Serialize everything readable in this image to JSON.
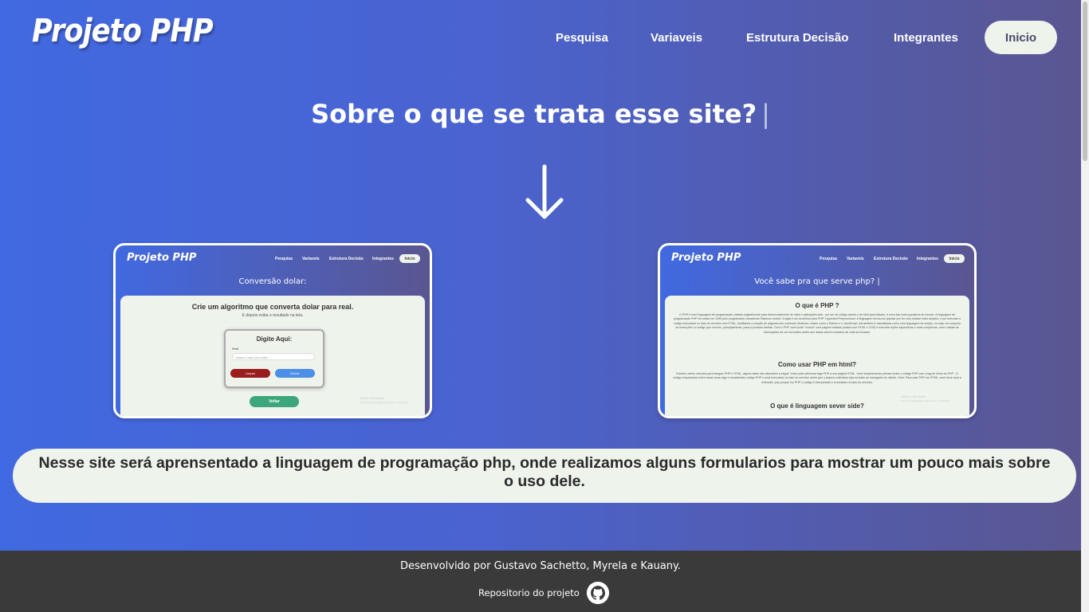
{
  "header": {
    "logo": "Projeto PHP",
    "nav": [
      "Pesquisa",
      "Variaveis",
      "Estrutura Decisão",
      "Integrantes"
    ],
    "home_button": "Inicio"
  },
  "hero": {
    "headline": "Sobre o que se trata esse site?",
    "caret": "|",
    "arrow_icon": "arrow-down-icon"
  },
  "preview_left": {
    "logo": "Projeto PHP",
    "nav": [
      "Pesquisa",
      "Variaveis",
      "Estrutura Decisão",
      "Integrantes"
    ],
    "home_button": "Inicio",
    "title": "Conversão dolar:",
    "panel_title": "Crie um algoritmo que converta dolar para real.",
    "panel_subtitle": "E depois exiba o resultado na tela.",
    "form_title": "Digite Aqui:",
    "form_label": "Real",
    "form_placeholder": "Insira o valor em reais",
    "clear_button": "Limpar",
    "send_button": "Enviar",
    "back_button": "Voltar",
    "watermark_line1": "Ativar o Windows",
    "watermark_line2": "Acesse Configurações para ativar o Windows."
  },
  "preview_right": {
    "logo": "Projeto PHP",
    "nav": [
      "Pesquisa",
      "Variaveis",
      "Estrutura Decisão",
      "Integrantes"
    ],
    "home_button": "Inicio",
    "title": "Você sabe pra que serve php? |",
    "section1_title": "O que é PHP ?",
    "section1_text": "O PHP é uma linguagem de programação voltada originalmente para desenvolvimento de sites e aplicações web , por ser de código aberto e de fácil aprendizado, é uma das mais populares do mundo. A linguagem de programação PHP foi criada em 1995 pelo programador canadense Rasmus Lerdorf. A sigla é um acrônimo para PHP: Hypertext Preprocessor. A linguagem tornou-se popular por ter uma sintaxe mais simples, e por executar o código executado no lado do servidor com HTML, facilitando a criação de páginas com conteúdo dinâmico. Assim como o Python e o JavaScript, ela também é classificada como uma linguagem de scripts, ou seja, um conjunto de instruções ou código que servem, principalmente, para a produtor tarefas. Com o PHP, você pode \"evoluir\" uma página estática (criada com HTML e CSS) e executar ações específicas e mais complexas, como validar as informações de um formulário antes dos dados serem enviados de volta ao browser.",
    "section2_title": "Como usar PHP em html?",
    "section2_text": "Existem vários métodos para integrar PHP e HTML, alguns deles são discutidos a seguir. Você pode adicionar tags PHP à sua página HTML. Você simplesmente precisa incluir o código PHP com a tag de início do PHP . O código empacotado entre essas duas tags é considerado código PHP e será executado no lado do servidor antes que o arquivo solicitado seja enviado ao navegador do cliente. Note: Para usar PHP em HTML, você deve usar a extensão .php porque em PHP o código é interpretado e executado no lado do servidor.",
    "section3_title": "O que é linguagem sever side?",
    "watermark_line1": "Ativar o Windows",
    "watermark_line2": "Acesse Configurações para ativar o Windows."
  },
  "description": "Nesse site será aprensentado a linguagem de programação php, onde realizamos alguns formularios para mostrar um pouco mais sobre o uso dele.",
  "footer": {
    "developed_by": "Desenvolvido por Gustavo Sachetto, Myrela e Kauany.",
    "repo_label": "Repositorio do projeto",
    "repo_icon": "github-icon"
  },
  "colors": {
    "gradient_start": "#4169e1",
    "gradient_end": "#5a5691",
    "panel_bg": "#eef3ec",
    "footer_bg": "#3a3a3a"
  }
}
